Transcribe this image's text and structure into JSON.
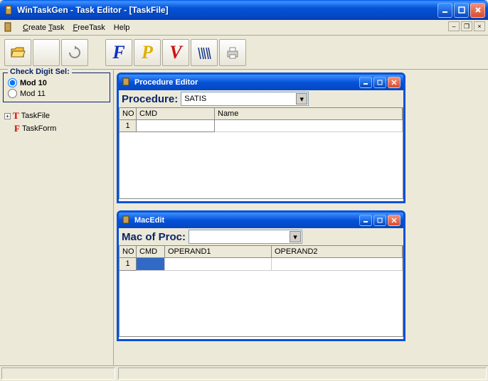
{
  "window": {
    "title": "WinTaskGen - Task Editor - [TaskFile]"
  },
  "menu": {
    "create": "Create Task",
    "free": "FreeTask",
    "help": "Help"
  },
  "toolbar": {
    "icons": [
      "folder-open-icon",
      "blank-icon",
      "refresh-icon",
      "script-f-icon",
      "script-p-icon",
      "script-v-icon",
      "barcode-icon",
      "printer-icon"
    ]
  },
  "check_digit": {
    "title": "Check Digit Sel:",
    "opt1": "Mod 10",
    "opt2": "Mod 11",
    "selected": "Mod 10"
  },
  "tree": {
    "items": [
      {
        "label": "TaskFile",
        "icon": "T",
        "color": "#d00000",
        "expandable": true
      },
      {
        "label": "TaskForm",
        "icon": "F",
        "color": "#d00000",
        "expandable": false
      }
    ]
  },
  "proc_editor": {
    "title": "Procedure Editor",
    "label": "Procedure:",
    "selected": "SATIS",
    "columns": {
      "no": "NO",
      "cmd": "CMD",
      "name": "Name"
    },
    "rows": [
      {
        "no": "1",
        "cmd": "",
        "name": ""
      }
    ]
  },
  "mac_edit": {
    "title": "MacEdit",
    "label": "Mac of Proc:",
    "selected": "",
    "columns": {
      "no": "NO",
      "cmd": "CMD",
      "op1": "OPERAND1",
      "op2": "OPERAND2"
    },
    "rows": [
      {
        "no": "1",
        "cmd": "",
        "op1": "",
        "op2": ""
      }
    ]
  }
}
